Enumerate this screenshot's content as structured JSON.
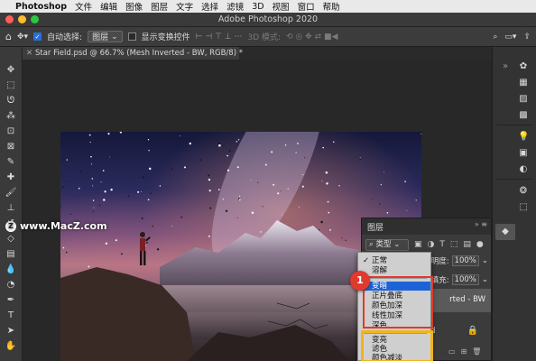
{
  "menubar": {
    "app": "Photoshop",
    "items": [
      "文件",
      "编辑",
      "图像",
      "图层",
      "文字",
      "选择",
      "滤镜",
      "3D",
      "视图",
      "窗口",
      "帮助"
    ]
  },
  "window": {
    "title": "Adobe Photoshop 2020"
  },
  "options": {
    "auto_select_label": "自动选择:",
    "auto_select_value": "图层",
    "show_transform_label": "显示变换控件",
    "mode_3d_label": "3D 模式:"
  },
  "document_tab": {
    "title": "Star Field.psd @ 66.7% (Mesh Inverted - BW, RGB/8) *"
  },
  "watermark": {
    "text": "www.MacZ.com"
  },
  "layers_panel": {
    "title": "图层",
    "kind_label": "类型",
    "opacity_label": "不透明度:",
    "opacity_value": "100%",
    "fill_label": "填充:",
    "fill_value": "100%",
    "layer_name": "rted - BW",
    "background_fragment": "d"
  },
  "blend_menu": {
    "group1": [
      "正常",
      "溶解"
    ],
    "group2": [
      "变暗",
      "正片叠底",
      "颜色加深",
      "线性加深",
      "深色"
    ],
    "group3": [
      "变亮",
      "滤色",
      "颜色减淡"
    ],
    "checked": "正常",
    "selected": "变暗"
  },
  "annotation": {
    "badge_number": "1"
  },
  "colors": {
    "highlight_red": "#e0392d",
    "highlight_yellow": "#f2b41c",
    "selection_blue": "#1e63d6"
  }
}
